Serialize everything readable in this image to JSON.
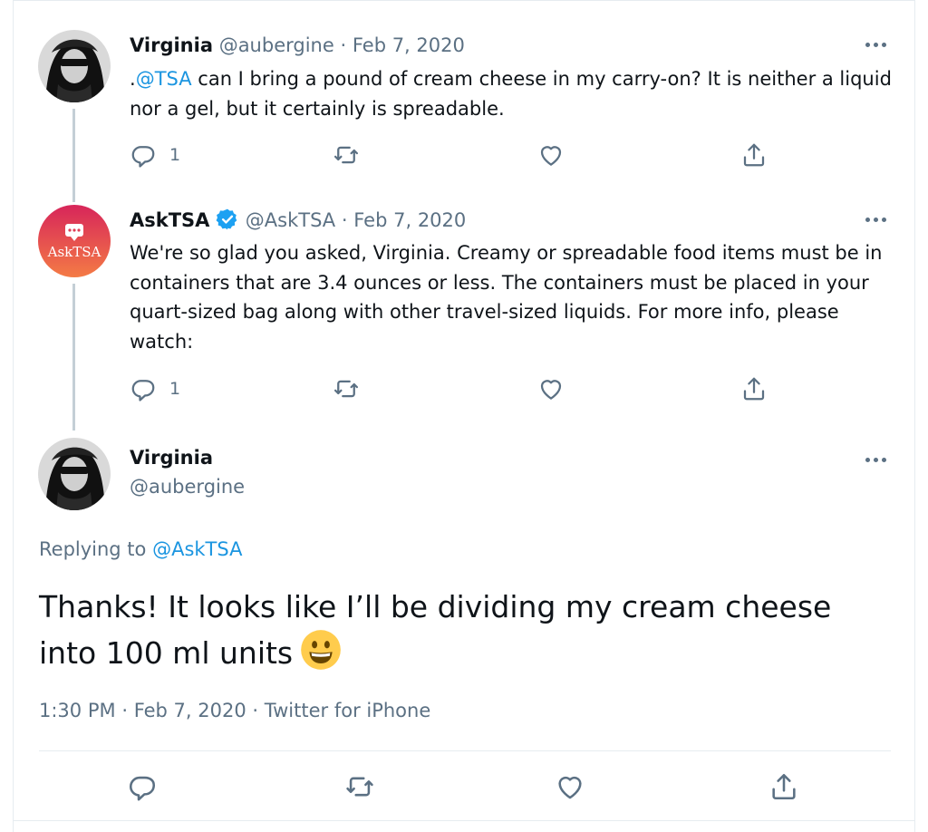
{
  "thread": [
    {
      "name": "Virginia",
      "handle": "@aubergine",
      "date_sep": "·",
      "date": "Feb 7, 2020",
      "avatar_icon": "user-avatar-photo",
      "text_prefix": ".",
      "mention": "@TSA",
      "text": " can I bring a pound of cream cheese in my carry-on? It is neither a liquid nor a gel, but it certainly is spreadable.",
      "reply_count": "1"
    },
    {
      "name": "AskTSA",
      "verified_icon": "verified-badge-icon",
      "handle": "@AskTSA",
      "date_sep": "·",
      "date": "Feb 7, 2020",
      "avatar_label": "AskTSA",
      "text": "We're so glad you asked, Virginia. Creamy or spreadable food items must be in containers that are 3.4 ounces or less. The containers must be placed in your quart-sized bag along with other travel-sized liquids. For more info, please watch:",
      "reply_count": "1"
    }
  ],
  "main_tweet": {
    "name": "Virginia",
    "handle": "@aubergine",
    "replying_prefix": "Replying to",
    "replying_to": "@AskTSA",
    "text": "Thanks! It looks like I’ll be dividing my cream cheese into 100 ml units",
    "emoji": "grinning-face-emoji",
    "time": "1:30 PM",
    "sep1": "·",
    "date": "Feb 7, 2020",
    "sep2": "·",
    "source": "Twitter for iPhone"
  },
  "colors": {
    "link": "#1b95e0",
    "muted": "#5b7083",
    "verified": "#1da1f2",
    "asktsa_gradient_top": "#d7255a",
    "asktsa_gradient_bottom": "#f47b45"
  }
}
